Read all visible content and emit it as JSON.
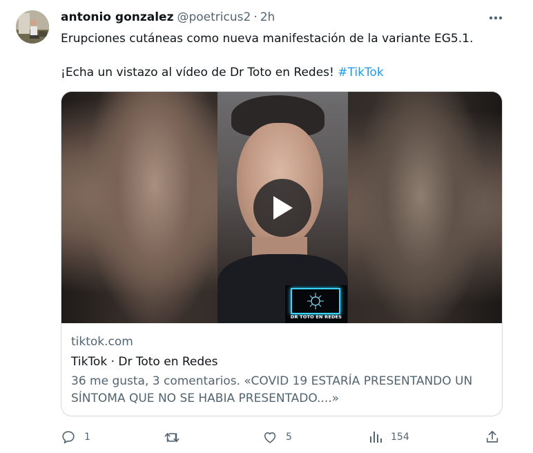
{
  "author": {
    "name": "antonio gonzalez",
    "handle": "@poetricus2",
    "separator": "·",
    "time": "2h"
  },
  "tweet": {
    "line1": "Erupciones cutáneas como nueva manifestación de la variante EG5.1.",
    "line2": "¡Echa un vistazo al vídeo de Dr Toto en Redes!",
    "hashtag": "#TikTok"
  },
  "card": {
    "video_logo_text": "DR TOTO EN REDES",
    "domain": "tiktok.com",
    "title": "TikTok · Dr Toto en Redes",
    "description": "36 me gusta, 3 comentarios. «COVID 19 ESTARÍA PRESENTANDO UN SÍNTOMA QUE NO SE HABIA PRESENTADO....»"
  },
  "actions": {
    "replies": "1",
    "retweets": "",
    "likes": "5",
    "views": "154"
  },
  "icons": {
    "more": "more-horizontal-icon",
    "reply": "reply-icon",
    "retweet": "retweet-icon",
    "like": "heart-icon",
    "views": "views-chart-icon",
    "share": "share-icon",
    "play": "play-icon"
  },
  "colors": {
    "text": "#0f1419",
    "muted": "#536471",
    "link": "#1d9bf0",
    "border": "#cfd9de"
  }
}
